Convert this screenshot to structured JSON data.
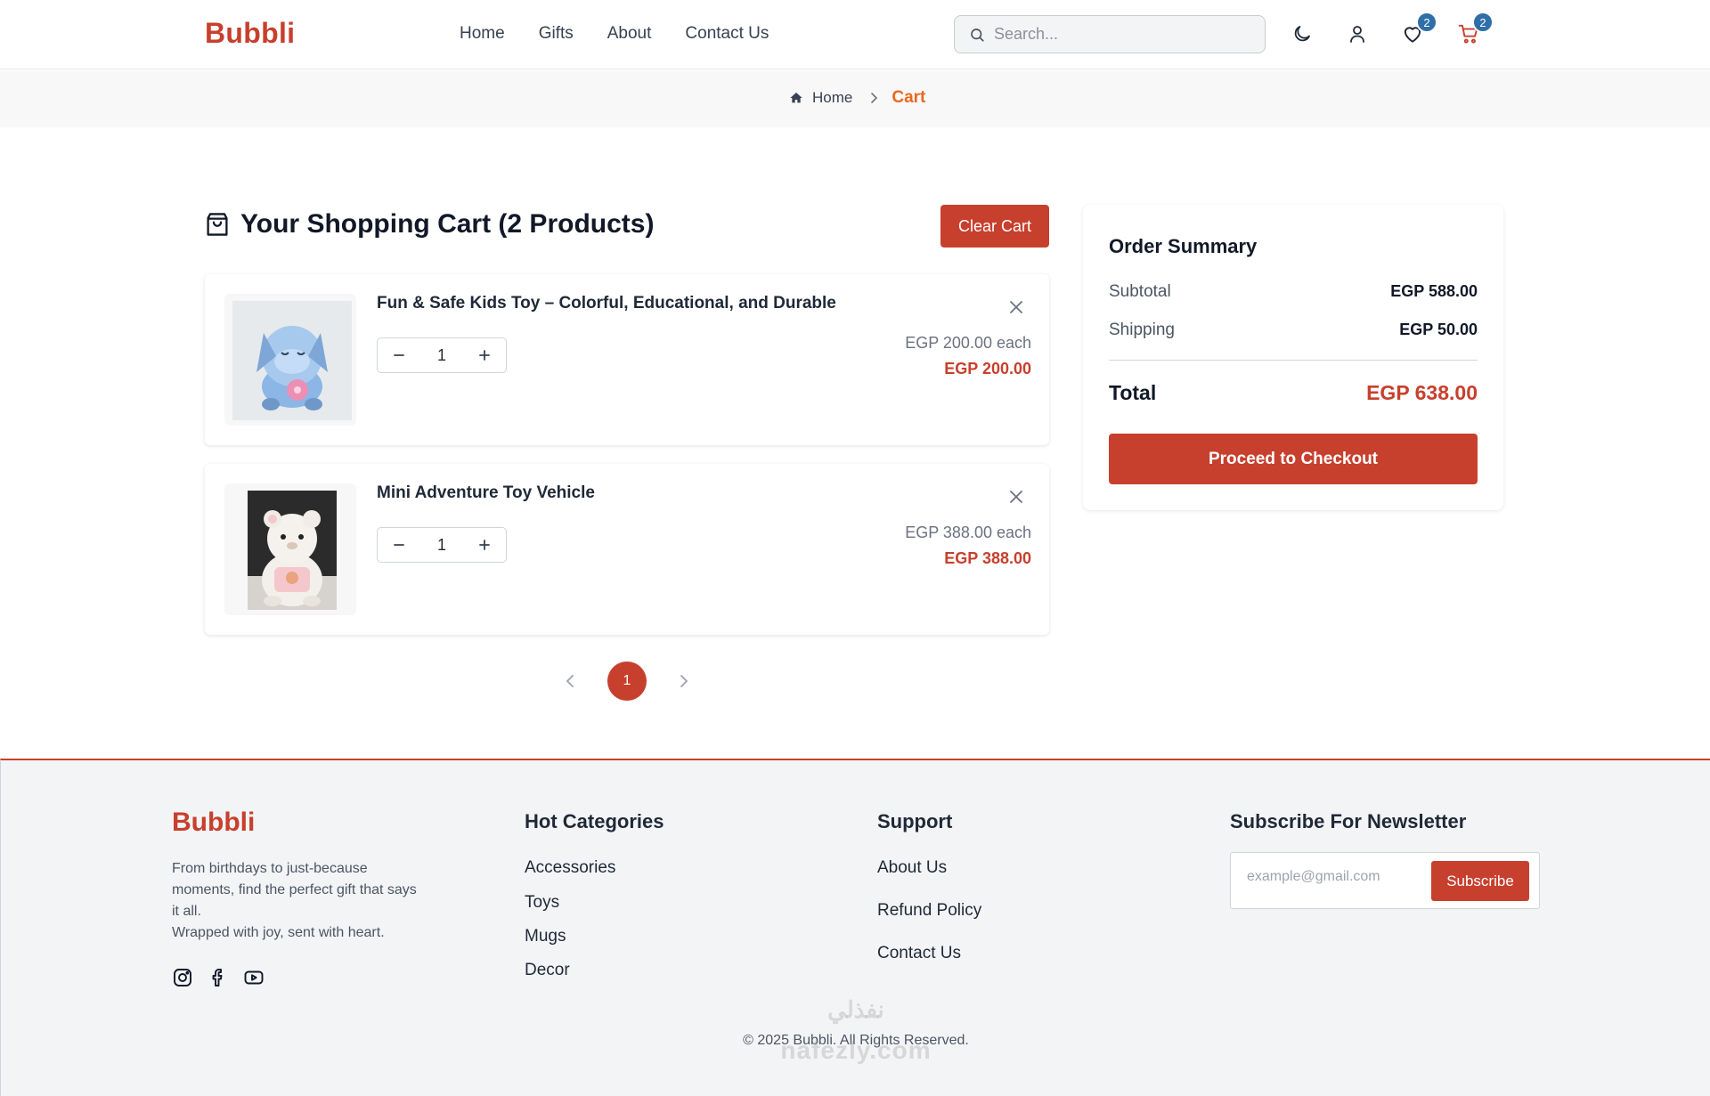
{
  "brand": "Bubbli",
  "nav": [
    "Home",
    "Gifts",
    "About",
    "Contact Us"
  ],
  "search": {
    "placeholder": "Search..."
  },
  "header": {
    "wishlist_count": "2",
    "cart_count": "2"
  },
  "breadcrumb": {
    "home": "Home",
    "current": "Cart"
  },
  "cart": {
    "title": "Your Shopping Cart (2 Products)",
    "clear_label": "Clear Cart",
    "items": [
      {
        "name": "Fun & Safe Kids Toy – Colorful, Educational, and Durable",
        "quantity": "1",
        "each": "EGP 200.00 each",
        "total": "EGP 200.00"
      },
      {
        "name": "Mini Adventure Toy Vehicle",
        "quantity": "1",
        "each": "EGP 388.00 each",
        "total": "EGP 388.00"
      }
    ],
    "page": "1"
  },
  "summary": {
    "title": "Order Summary",
    "subtotal_label": "Subtotal",
    "subtotal": "EGP 588.00",
    "shipping_label": "Shipping",
    "shipping": "EGP 50.00",
    "total_label": "Total",
    "total": "EGP 638.00",
    "checkout_label": "Proceed to Checkout"
  },
  "footer": {
    "brand": "Bubbli",
    "desc_line1": "From birthdays to just-because moments, find the perfect gift that says it all.",
    "desc_line2": "Wrapped with joy, sent with heart.",
    "hot_title": "Hot Categories",
    "hot": [
      "Accessories",
      "Toys",
      "Mugs",
      "Decor"
    ],
    "support_title": "Support",
    "support": [
      "About Us",
      "Refund Policy",
      "Contact Us"
    ],
    "newsletter_title": "Subscribe For Newsletter",
    "newsletter_placeholder": "example@gmail.com",
    "subscribe_label": "Subscribe",
    "copyright": "© 2025 Bubbli. All Rights Reserved.",
    "watermark_ar": "نفذلي",
    "watermark_en": "nafezly.com"
  },
  "colors": {
    "brand": "#c7402d",
    "accent_orange": "#e8691f",
    "badge": "#2f6fa8"
  },
  "icons": [
    "search-icon",
    "moon-icon",
    "user-icon",
    "heart-icon",
    "cart-icon",
    "home-icon",
    "chevron-right-icon",
    "shopping-bag-icon",
    "close-icon",
    "minus-icon",
    "plus-icon",
    "chevron-left-icon",
    "instagram-icon",
    "facebook-icon",
    "youtube-icon"
  ]
}
